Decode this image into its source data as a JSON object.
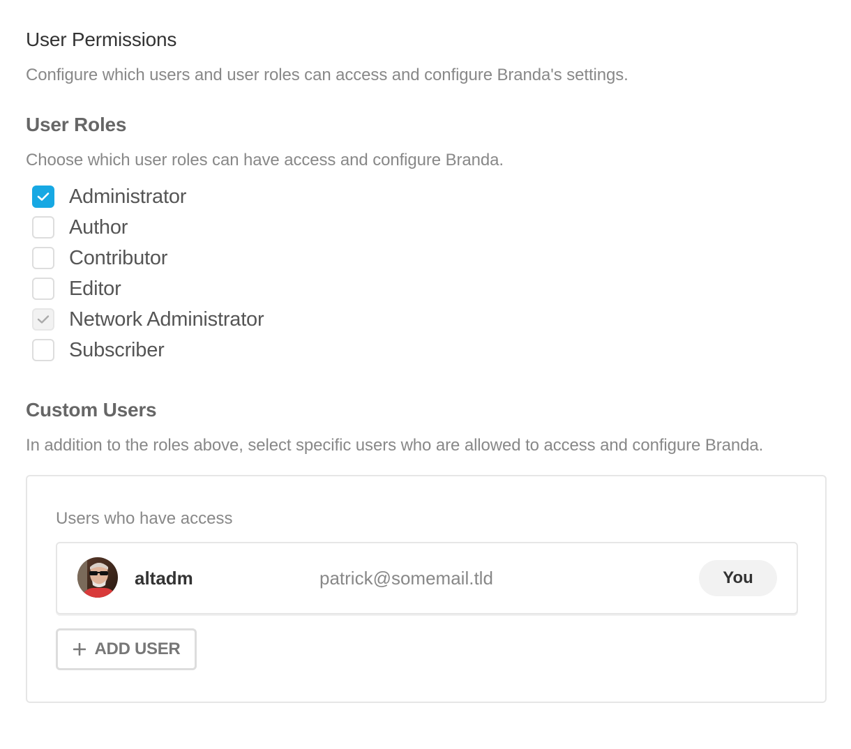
{
  "permissions": {
    "title": "User Permissions",
    "description": "Configure which users and user roles can access and configure Branda's settings."
  },
  "roles": {
    "title": "User Roles",
    "description": "Choose which user roles can have access and configure Branda.",
    "items": [
      {
        "label": "Administrator",
        "checked": true,
        "disabled": false
      },
      {
        "label": "Author",
        "checked": false,
        "disabled": false
      },
      {
        "label": "Contributor",
        "checked": false,
        "disabled": false
      },
      {
        "label": "Editor",
        "checked": false,
        "disabled": false
      },
      {
        "label": "Network Administrator",
        "checked": true,
        "disabled": true
      },
      {
        "label": "Subscriber",
        "checked": false,
        "disabled": false
      }
    ]
  },
  "custom_users": {
    "title": "Custom Users",
    "description": "In addition to the roles above, select specific users who are allowed to access and configure Branda.",
    "list_label": "Users who have access",
    "users": [
      {
        "username": "altadm",
        "email": "patrick@somemail.tld",
        "tag": "You"
      }
    ],
    "add_button_label": "ADD USER",
    "add_icon": "plus-icon"
  },
  "colors": {
    "accent": "#17a8e3",
    "heading": "#333333",
    "subheading": "#666666",
    "muted_text": "#888888",
    "border": "#e6e6e6",
    "tag_bg": "#f2f2f2"
  }
}
